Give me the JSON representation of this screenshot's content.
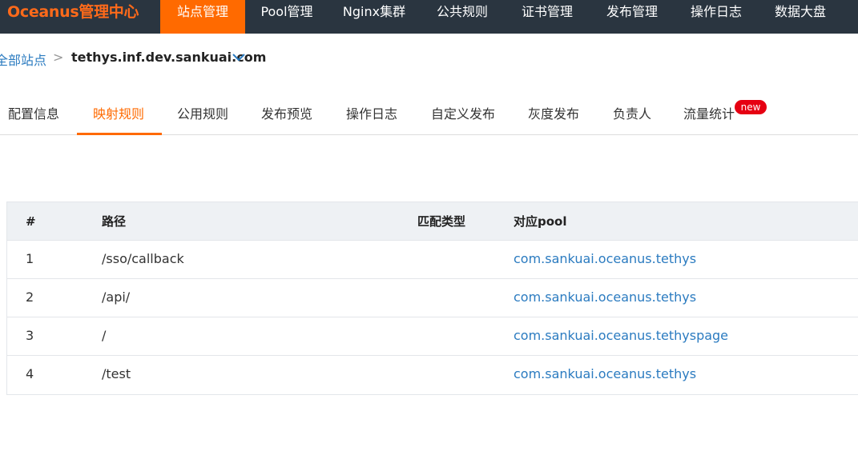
{
  "topnav": {
    "brand": "Oceanus管理中心",
    "items": [
      "站点管理",
      "Pool管理",
      "Nginx集群",
      "公共规则",
      "证书管理",
      "发布管理",
      "操作日志",
      "数据大盘"
    ],
    "active_index": 0
  },
  "breadcrumb": {
    "root": "全部站点",
    "separator": ">",
    "current": "tethys.inf.dev.sankuai.com"
  },
  "tabs": {
    "items": [
      "配置信息",
      "映射规则",
      "公用规则",
      "发布预览",
      "操作日志",
      "自定义发布",
      "灰度发布",
      "负责人",
      "流量统计"
    ],
    "active_index": 1,
    "badge": "new"
  },
  "table": {
    "headers": [
      "#",
      "路径",
      "匹配类型",
      "对应pool"
    ],
    "rows": [
      [
        "1",
        "/sso/callback",
        "",
        "com.sankuai.oceanus.tethys"
      ],
      [
        "2",
        "/api/",
        "",
        "com.sankuai.oceanus.tethys"
      ],
      [
        "3",
        "/",
        "",
        "com.sankuai.oceanus.tethyspage"
      ],
      [
        "4",
        "/test",
        "",
        "com.sankuai.oceanus.tethys"
      ]
    ]
  },
  "colors": {
    "nav_bg": "#2a3540",
    "accent": "#ff6a00",
    "link": "#2b7bc0",
    "badge": "#e60012"
  }
}
